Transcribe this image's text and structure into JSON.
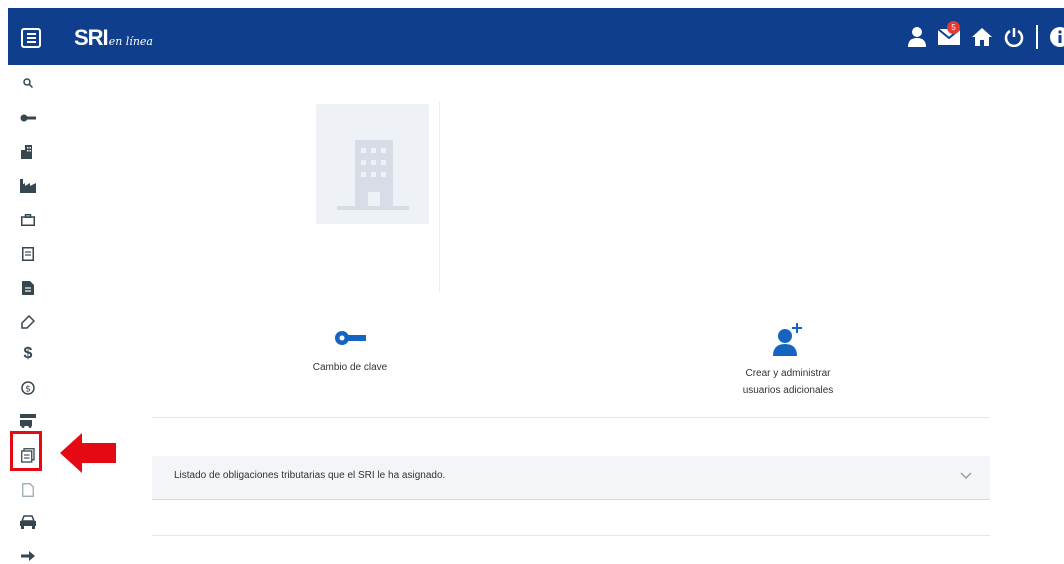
{
  "header": {
    "logo_main": "SRI",
    "logo_sub": "en línea",
    "notification_count": "5",
    "bar_color": "#0f3f8c"
  },
  "sidebar": {
    "icons": [
      "search-icon",
      "key-icon",
      "buildings-icon",
      "factory-icon",
      "suitcase-icon",
      "document-icon",
      "document-filled-icon",
      "tag-icon",
      "dollar-icon",
      "coin-icon",
      "truck-icon",
      "calendar-doc-icon",
      "blank-doc-icon",
      "car-icon",
      "arrow-right-icon"
    ],
    "highlighted_icon": "calendar-doc-icon",
    "highlight_color": "#e50914"
  },
  "main": {
    "actions": [
      {
        "label": "Cambio de clave",
        "icon": "key-icon"
      },
      {
        "label": "Crear y administrar usuarios adicionales",
        "icon": "add-user-icon"
      }
    ],
    "accordion": {
      "title": "Listado de obligaciones tributarias que el SRI le ha asignado."
    }
  }
}
